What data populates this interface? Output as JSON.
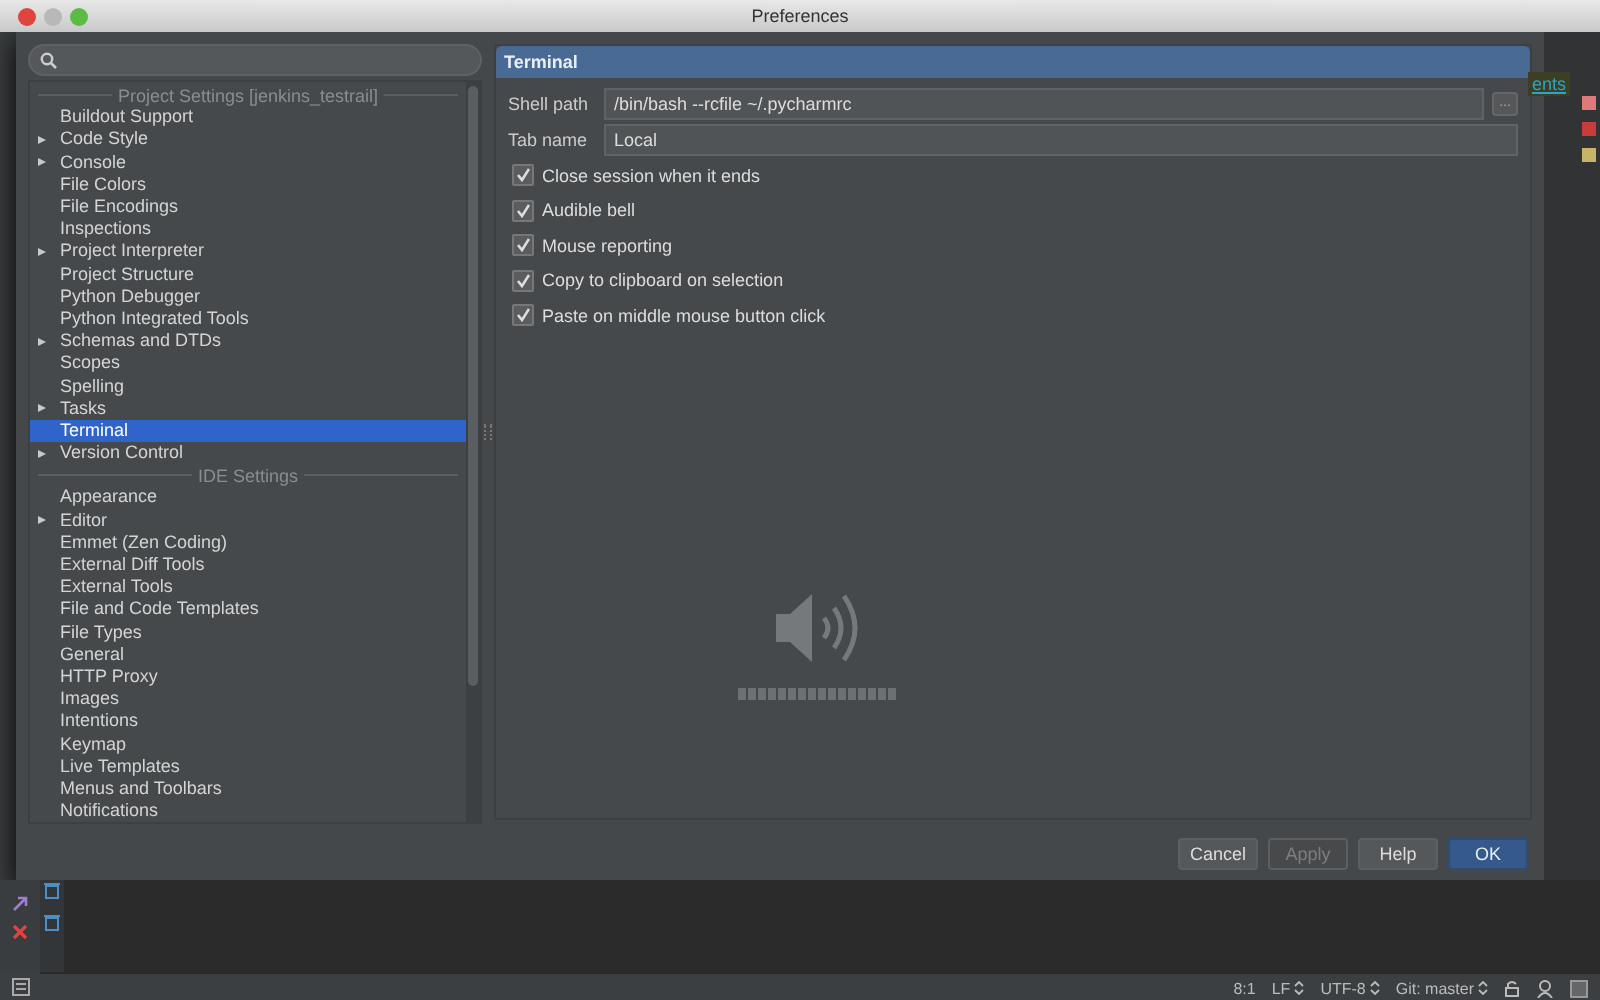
{
  "window": {
    "title": "Preferences"
  },
  "sections": [
    {
      "title": "Project Settings [jenkins_testrail]",
      "items": [
        {
          "label": "Buildout Support",
          "collapsed": false,
          "selected": false
        },
        {
          "label": "Code Style",
          "collapsed": true,
          "selected": false
        },
        {
          "label": "Console",
          "collapsed": true,
          "selected": false
        },
        {
          "label": "File Colors",
          "collapsed": false,
          "selected": false
        },
        {
          "label": "File Encodings",
          "collapsed": false,
          "selected": false
        },
        {
          "label": "Inspections",
          "collapsed": false,
          "selected": false
        },
        {
          "label": "Project Interpreter",
          "collapsed": true,
          "selected": false
        },
        {
          "label": "Project Structure",
          "collapsed": false,
          "selected": false
        },
        {
          "label": "Python Debugger",
          "collapsed": false,
          "selected": false
        },
        {
          "label": "Python Integrated Tools",
          "collapsed": false,
          "selected": false
        },
        {
          "label": "Schemas and DTDs",
          "collapsed": true,
          "selected": false
        },
        {
          "label": "Scopes",
          "collapsed": false,
          "selected": false
        },
        {
          "label": "Spelling",
          "collapsed": false,
          "selected": false
        },
        {
          "label": "Tasks",
          "collapsed": true,
          "selected": false
        },
        {
          "label": "Terminal",
          "collapsed": false,
          "selected": true
        },
        {
          "label": "Version Control",
          "collapsed": true,
          "selected": false
        }
      ]
    },
    {
      "title": "IDE Settings",
      "items": [
        {
          "label": "Appearance",
          "collapsed": false,
          "selected": false
        },
        {
          "label": "Editor",
          "collapsed": true,
          "selected": false
        },
        {
          "label": "Emmet (Zen Coding)",
          "collapsed": false,
          "selected": false
        },
        {
          "label": "External Diff Tools",
          "collapsed": false,
          "selected": false
        },
        {
          "label": "External Tools",
          "collapsed": false,
          "selected": false
        },
        {
          "label": "File and Code Templates",
          "collapsed": false,
          "selected": false
        },
        {
          "label": "File Types",
          "collapsed": false,
          "selected": false
        },
        {
          "label": "General",
          "collapsed": false,
          "selected": false
        },
        {
          "label": "HTTP Proxy",
          "collapsed": false,
          "selected": false
        },
        {
          "label": "Images",
          "collapsed": false,
          "selected": false
        },
        {
          "label": "Intentions",
          "collapsed": false,
          "selected": false
        },
        {
          "label": "Keymap",
          "collapsed": false,
          "selected": false
        },
        {
          "label": "Live Templates",
          "collapsed": false,
          "selected": false
        },
        {
          "label": "Menus and Toolbars",
          "collapsed": false,
          "selected": false
        },
        {
          "label": "Notifications",
          "collapsed": false,
          "selected": false
        }
      ]
    }
  ],
  "panel": {
    "title": "Terminal",
    "fields": [
      {
        "label": "Shell path",
        "value": "/bin/bash --rcfile ~/.pycharmrc",
        "browse": "..."
      },
      {
        "label": "Tab name",
        "value": "Local"
      }
    ],
    "options": [
      {
        "label": "Close session when it ends",
        "checked": true
      },
      {
        "label": "Audible bell",
        "checked": true
      },
      {
        "label": "Mouse reporting",
        "checked": true
      },
      {
        "label": "Copy to clipboard on selection",
        "checked": true
      },
      {
        "label": "Paste on middle mouse button click",
        "checked": true
      }
    ]
  },
  "volume_hud": {
    "level": 1
  },
  "buttons": [
    {
      "label": "Cancel",
      "kind": "normal",
      "disabled": false
    },
    {
      "label": "Apply",
      "kind": "normal",
      "disabled": true
    },
    {
      "label": "Help",
      "kind": "normal",
      "disabled": false
    },
    {
      "label": "OK",
      "kind": "default",
      "disabled": false
    }
  ],
  "background_link": "ents",
  "status_bar": [
    {
      "text": "8:1",
      "kind": "text"
    },
    {
      "text": "LF",
      "kind": "dropdown"
    },
    {
      "text": "UTF-8",
      "kind": "dropdown"
    },
    {
      "text": "Git: master",
      "kind": "dropdown"
    }
  ]
}
